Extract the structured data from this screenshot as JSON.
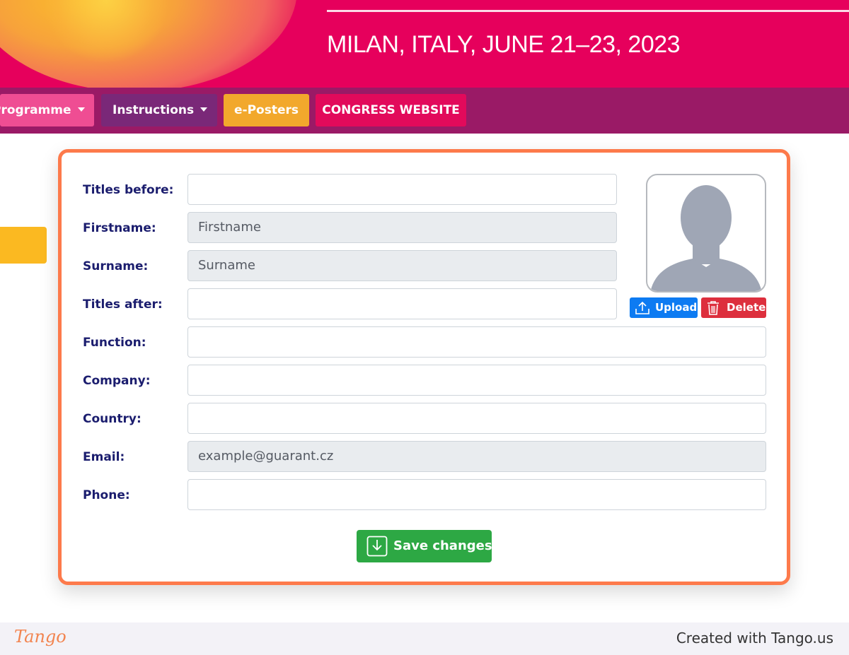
{
  "banner": {
    "location_date": "MILAN, ITALY, JUNE 21–23, 2023"
  },
  "nav": {
    "items": [
      {
        "label": "Programme"
      },
      {
        "label": "Instructions"
      },
      {
        "label": "e-Posters"
      },
      {
        "label": "CONGRESS WEBSITE"
      }
    ]
  },
  "form": {
    "fields": [
      {
        "label": "Titles before:",
        "value": "",
        "readonly": false
      },
      {
        "label": "Firstname:",
        "value": "Firstname",
        "readonly": true
      },
      {
        "label": "Surname:",
        "value": "Surname",
        "readonly": true
      },
      {
        "label": "Titles after:",
        "value": "",
        "readonly": false
      },
      {
        "label": "Function:",
        "value": "",
        "readonly": false
      },
      {
        "label": "Company:",
        "value": "",
        "readonly": false
      },
      {
        "label": "Country:",
        "value": "",
        "readonly": false
      },
      {
        "label": "Email:",
        "value": "example@guarant.cz",
        "readonly": true
      },
      {
        "label": "Phone:",
        "value": "",
        "readonly": false
      }
    ],
    "photo": {
      "upload_label": "Upload",
      "delete_label": "Delete"
    },
    "save_label": "Save changes"
  },
  "colors": {
    "banner": "#e6005c",
    "nav_bar": "#9a1a66",
    "card_border": "#fd7a4b",
    "label_text": "#1b1d6e",
    "upload": "#0d7bf2",
    "delete": "#dd2f3d",
    "save": "#2da844"
  },
  "icons": {
    "avatar": "person-silhouette-icon",
    "upload": "upload-icon",
    "delete": "trash-icon",
    "save": "save-download-icon"
  },
  "footer": {
    "logo": "Tango",
    "credit": "Created with Tango.us"
  }
}
